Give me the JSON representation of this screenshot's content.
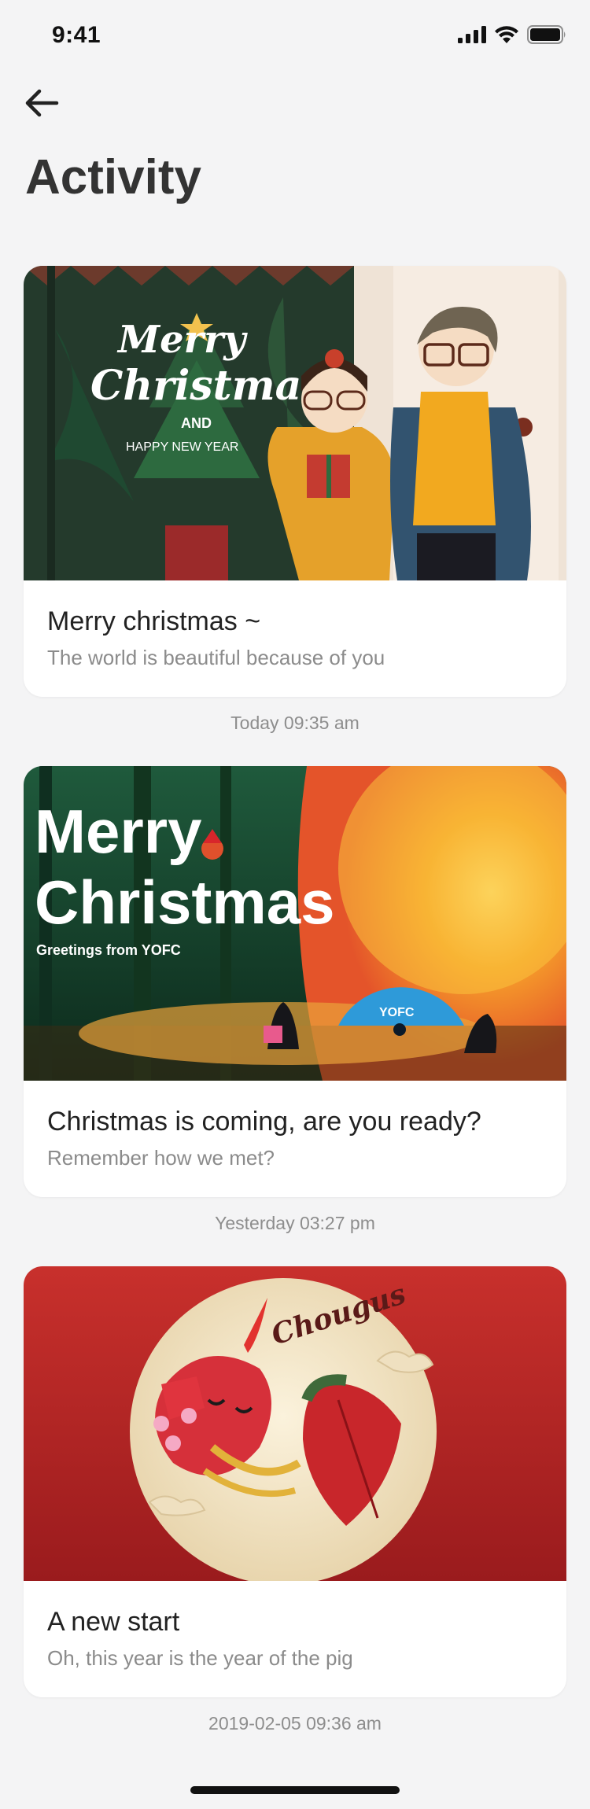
{
  "status_bar": {
    "time": "9:41"
  },
  "header": {
    "title": "Activity"
  },
  "activities": [
    {
      "title": "Merry christmas ~",
      "subtitle": "The world is beautiful because of you",
      "timestamp": "Today 09:35 am",
      "image_text": {
        "line1": "Merry",
        "line2": "Christmas",
        "line3": "AND",
        "line4": "HAPPY NEW YEAR"
      }
    },
    {
      "title": "Christmas is coming, are you ready?",
      "subtitle": "Remember how we met?",
      "timestamp": "Yesterday 03:27 pm",
      "image_text": {
        "line1": "Merry",
        "line2": "Christmas",
        "line3": "Greetings from YOFC",
        "brand": "YOFC"
      }
    },
    {
      "title": "A new start",
      "subtitle": "Oh, this year is the year of the pig",
      "timestamp": "2019-02-05 09:36 am",
      "image_text": {
        "brand": "Chougus"
      }
    }
  ]
}
